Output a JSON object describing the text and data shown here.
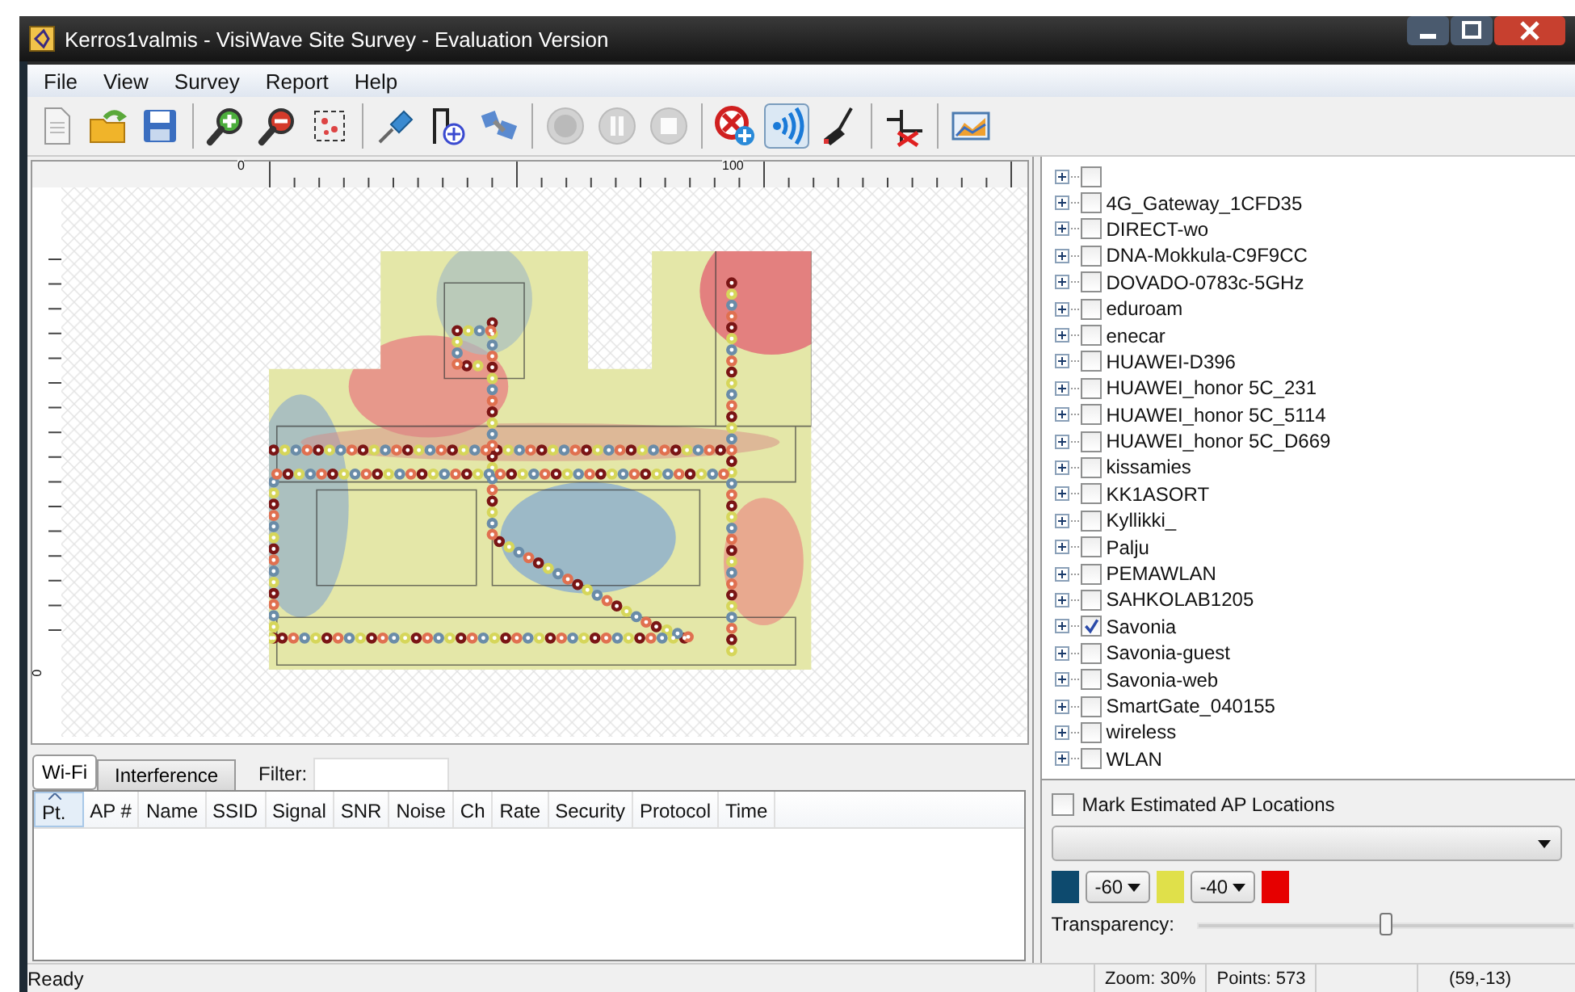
{
  "window": {
    "title": "Kerros1valmis - VisiWave Site Survey - Evaluation Version"
  },
  "menu": [
    "File",
    "View",
    "Survey",
    "Report",
    "Help"
  ],
  "toolbar": [
    [
      {
        "kind": "new-document",
        "pressed": false,
        "disabled": false
      },
      {
        "kind": "open-folder",
        "pressed": false,
        "disabled": false
      },
      {
        "kind": "save",
        "pressed": false,
        "disabled": false
      }
    ],
    [
      {
        "kind": "zoom-in",
        "pressed": false,
        "disabled": false
      },
      {
        "kind": "zoom-out",
        "pressed": false,
        "disabled": false
      },
      {
        "kind": "select-region",
        "pressed": false,
        "disabled": false
      }
    ],
    [
      {
        "kind": "pin",
        "pressed": false,
        "disabled": false
      },
      {
        "kind": "add-point",
        "pressed": false,
        "disabled": false
      },
      {
        "kind": "devices",
        "pressed": false,
        "disabled": false
      }
    ],
    [
      {
        "kind": "record",
        "pressed": false,
        "disabled": true
      },
      {
        "kind": "pause",
        "pressed": false,
        "disabled": true
      },
      {
        "kind": "stop",
        "pressed": false,
        "disabled": true
      }
    ],
    [
      {
        "kind": "blocked",
        "pressed": false,
        "disabled": false
      },
      {
        "kind": "wifi",
        "pressed": true,
        "disabled": false
      },
      {
        "kind": "probe",
        "pressed": false,
        "disabled": false
      }
    ],
    [
      {
        "kind": "delete-route",
        "pressed": false,
        "disabled": false
      }
    ],
    [
      {
        "kind": "chart",
        "pressed": false,
        "disabled": false
      }
    ]
  ],
  "ruler": {
    "top_labels": [
      "0",
      "100"
    ],
    "left_labels": [
      "0"
    ]
  },
  "bottom_tabs": [
    {
      "label": "Wi-Fi",
      "selected": true
    },
    {
      "label": "Interference",
      "selected": false
    }
  ],
  "filter": {
    "label": "Filter:"
  },
  "table": {
    "columns": [
      {
        "label": "Pt.",
        "sorted": true
      },
      {
        "label": "AP #",
        "sorted": false
      },
      {
        "label": "Name",
        "sorted": false
      },
      {
        "label": "SSID",
        "sorted": false
      },
      {
        "label": "Signal",
        "sorted": false
      },
      {
        "label": "SNR",
        "sorted": false
      },
      {
        "label": "Noise",
        "sorted": false
      },
      {
        "label": "Ch",
        "sorted": false
      },
      {
        "label": "Rate",
        "sorted": false
      },
      {
        "label": "Security",
        "sorted": false
      },
      {
        "label": "Protocol",
        "sorted": false
      },
      {
        "label": "Time",
        "sorted": false
      }
    ]
  },
  "networks": [
    {
      "checked": false,
      "expanded": false
    },
    {
      "label": "4G_Gateway_1CFD35",
      "checked": false,
      "expanded": false
    },
    {
      "label": "DIRECT-wo",
      "checked": false,
      "expanded": false
    },
    {
      "label": "DNA-Mokkula-C9F9CC",
      "checked": false,
      "expanded": false
    },
    {
      "label": "DOVADO-0783c-5GHz",
      "checked": false,
      "expanded": false
    },
    {
      "label": "eduroam",
      "checked": false,
      "expanded": false
    },
    {
      "label": "enecar",
      "checked": false,
      "expanded": false
    },
    {
      "label": "HUAWEI-D396",
      "checked": false,
      "expanded": false
    },
    {
      "label": "HUAWEI_honor 5C_231",
      "checked": false,
      "expanded": false
    },
    {
      "label": "HUAWEI_honor 5C_5114",
      "checked": false,
      "expanded": false
    },
    {
      "label": "HUAWEI_honor 5C_D669",
      "checked": false,
      "expanded": false
    },
    {
      "label": "kissamies",
      "checked": false,
      "expanded": false
    },
    {
      "label": "KK1ASORT",
      "checked": false,
      "expanded": false
    },
    {
      "label": "Kyllikki_",
      "checked": false,
      "expanded": false
    },
    {
      "label": "Palju",
      "checked": false,
      "expanded": false
    },
    {
      "label": "PEMAWLAN",
      "checked": false,
      "expanded": false
    },
    {
      "label": "SAHKOLAB1205",
      "checked": false,
      "expanded": false
    },
    {
      "label": "Savonia",
      "checked": true,
      "expanded": false
    },
    {
      "label": "Savonia-guest",
      "checked": false,
      "expanded": false
    },
    {
      "label": "Savonia-web",
      "checked": false,
      "expanded": false
    },
    {
      "label": "SmartGate_040155",
      "checked": false,
      "expanded": false
    },
    {
      "label": "wireless",
      "checked": false,
      "expanded": false
    },
    {
      "label": "WLAN",
      "checked": false,
      "expanded": false
    }
  ],
  "mark_estimated": {
    "label": "Mark Estimated AP Locations",
    "checked": false
  },
  "scale": [
    {
      "kind": "swatch",
      "color": "#0d4a6e"
    },
    {
      "kind": "select",
      "value": "-60"
    },
    {
      "kind": "swatch",
      "color": "#e0e04a"
    },
    {
      "kind": "select",
      "value": "-40"
    },
    {
      "kind": "swatch",
      "color": "#e60000"
    }
  ],
  "transparency": {
    "label": "Transparency:",
    "level": 0.5
  },
  "status_bar": {
    "message": "Ready",
    "zoom": "Zoom: 30%",
    "points": "Points: 573",
    "position": "(59,-13)"
  }
}
